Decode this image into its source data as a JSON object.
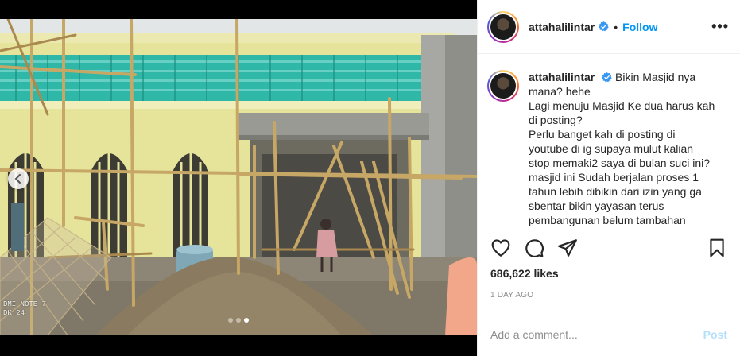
{
  "header": {
    "username": "attahalilintar",
    "follow_label": "Follow",
    "more_label": "•••"
  },
  "caption": {
    "username": "attahalilintar",
    "lines": [
      "Bikin Masjid nya",
      "mana? hehe",
      "Lagi menuju Masjid Ke dua harus kah",
      "di posting?",
      "Perlu banget kah di posting di",
      "youtube di ig supaya mulut kalian",
      "stop memaki2 saya di bulan suci ini?",
      "masjid ini Sudah berjalan proses 1",
      "tahun lebih dibikin dari izin yang ga",
      "sbentar bikin yayasan terus",
      "pembangunan belum tambahan"
    ]
  },
  "stats": {
    "likes": "686,622 likes",
    "time_ago": "1 DAY AGO"
  },
  "comment": {
    "placeholder": "Add a comment...",
    "post_label": "Post"
  },
  "media": {
    "watermark_line1": "DMI NOTE 7",
    "watermark_line2": "DK:24",
    "carousel_total": 3,
    "carousel_active": 3
  },
  "colors": {
    "follow": "#0095f6",
    "post_disabled": "#b2dffc",
    "verified": "#3897f0",
    "wall_yellow": "#e6e39a",
    "lattice_teal": "#2fb8a8"
  },
  "icons": {
    "like": "heart-icon",
    "comment": "comment-icon",
    "share": "paper-plane-icon",
    "save": "bookmark-icon",
    "prev": "chevron-left-icon"
  }
}
